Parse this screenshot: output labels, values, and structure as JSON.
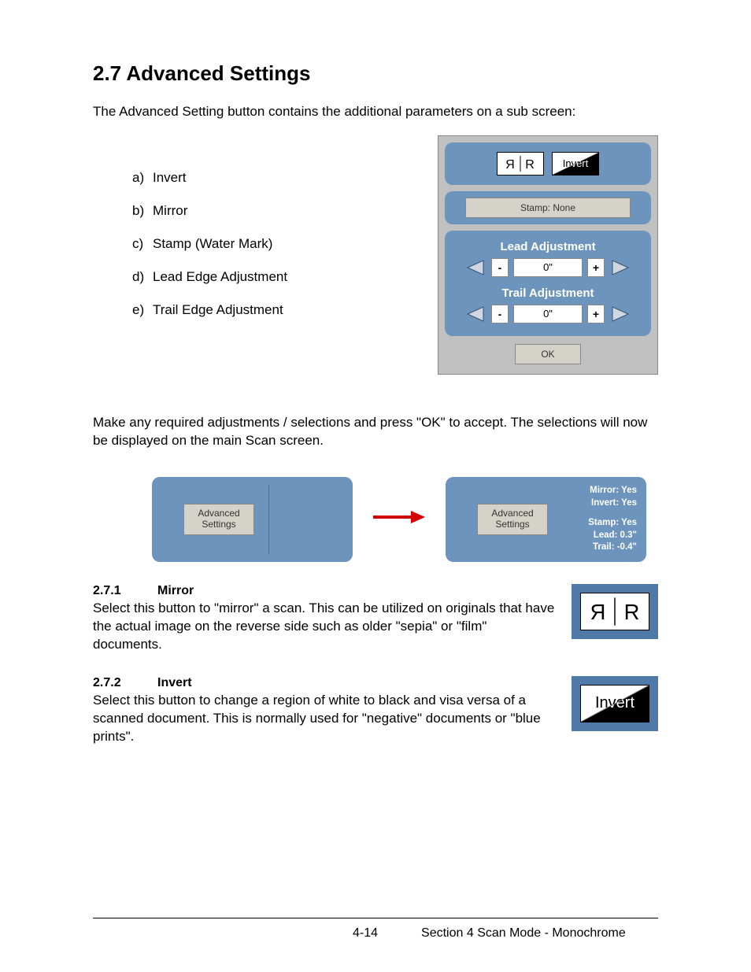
{
  "heading": "2.7  Advanced Settings",
  "intro": "The Advanced Setting button contains the additional parameters on a sub screen:",
  "features": {
    "a": "Invert",
    "b": "Mirror",
    "c": "Stamp (Water Mark)",
    "d": "Lead Edge Adjustment",
    "e": "Trail Edge Adjustment"
  },
  "dialog": {
    "mirror_label": "ЯR",
    "invert_label": "Invert",
    "stamp_label": "Stamp: None",
    "lead_label": "Lead Adjustment",
    "lead_value": "0\"",
    "trail_label": "Trail Adjustment",
    "trail_value": "0\"",
    "minus": "-",
    "plus": "+",
    "ok": "OK"
  },
  "mid_text": "Make any required adjustments / selections and press \"OK\" to accept. The selections will now be displayed on the main Scan screen.",
  "panels": {
    "adv_btn_l1": "Advanced",
    "adv_btn_l2": "Settings",
    "status": {
      "mirror": "Mirror: Yes",
      "invert": "Invert: Yes",
      "stamp": "Stamp: Yes",
      "lead": "Lead: 0.3\"",
      "trail": "Trail: -0.4\""
    }
  },
  "sub1": {
    "num": "2.7.1",
    "title": "Mirror",
    "body": "Select this button to \"mirror\" a scan. This can be utilized on originals that have the actual image on the reverse side such as older \"sepia\" or \"film\" documents.",
    "icon_text": "ЯR"
  },
  "sub2": {
    "num": "2.7.2",
    "title": "Invert",
    "body": "Select this button to change a region of white to black and visa versa of a scanned document. This is normally used for \"negative\" documents or \"blue prints\".",
    "icon_text": "Invert"
  },
  "footer": {
    "page": "4-14",
    "section": "Section 4     Scan Mode - Monochrome"
  }
}
